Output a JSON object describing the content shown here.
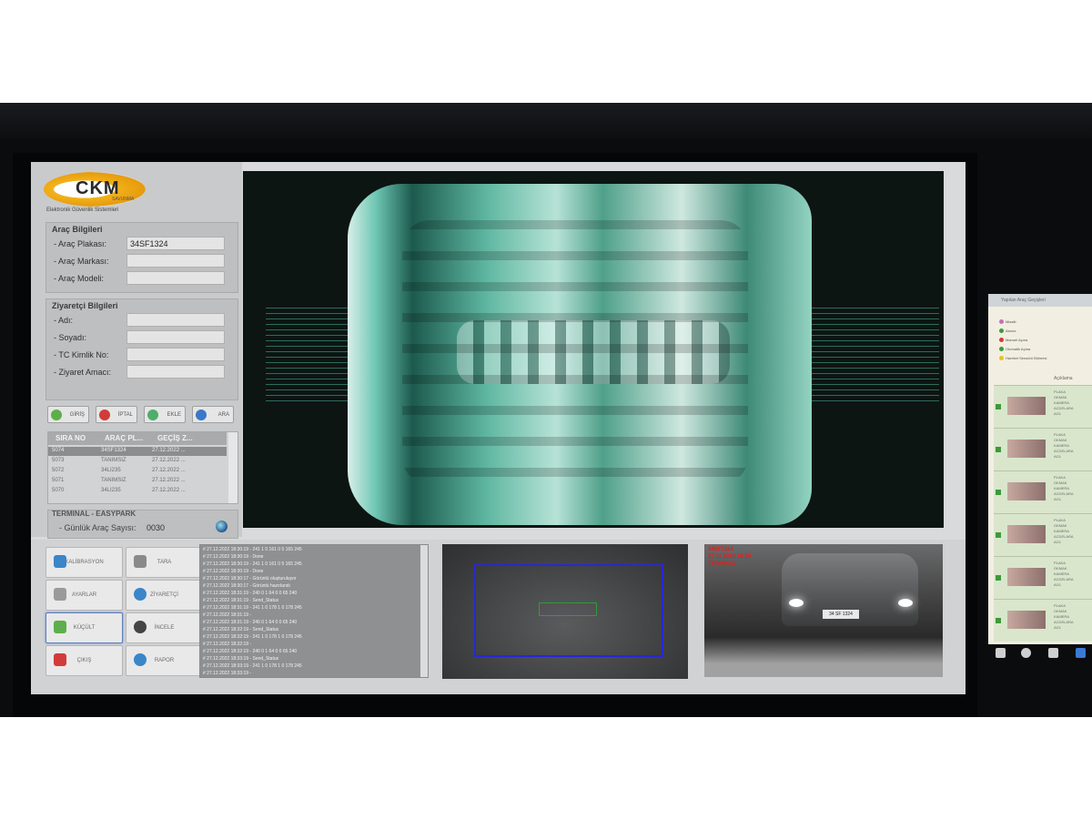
{
  "logo": {
    "name": "CKM",
    "sub": "SAVUNMA",
    "tagline": "Elektronik Güvenlik Sistemleri"
  },
  "vehicle_info": {
    "title": "Araç Bilgileri",
    "plate_label": "- Araç Plakası:",
    "plate_value": "34SF1324",
    "brand_label": "- Araç Markası:",
    "brand_value": "",
    "model_label": "- Araç Modeli:",
    "model_value": ""
  },
  "visitor_info": {
    "title": "Ziyaretçi Bilgileri",
    "name_label": "- Adı:",
    "surname_label": "- Soyadı:",
    "tc_label": "- TC Kimlik No:",
    "purpose_label": "- Ziyaret Amacı:"
  },
  "action_buttons": {
    "giris": "GİRİŞ",
    "iptal": "İPTAL",
    "ekle": "EKLE",
    "ara": "ARA"
  },
  "table": {
    "headers": [
      "SIRA NO",
      "ARAÇ PL...",
      "GEÇİŞ Z..."
    ],
    "rows": [
      [
        "5074",
        "34SF1324",
        "27.12.2022 ..."
      ],
      [
        "5073",
        "TANIMSIZ",
        "27.12.2022 ..."
      ],
      [
        "5072",
        "34LI235",
        "27.12.2022 ..."
      ],
      [
        "5071",
        "TANIMSIZ",
        "27.12.2022 ..."
      ],
      [
        "5070",
        "34LI235",
        "27.12.2022 ..."
      ]
    ]
  },
  "terminal": {
    "title": "TERMINAL - EASYPARK",
    "daily_label": "- Günlük Araç Sayısı:",
    "daily_value": "0030"
  },
  "bottom_buttons": {
    "kalibrasyon": "KALİBRASYON",
    "tara": "TARA",
    "ayarlar": "AYARLAR",
    "ziyaretci": "ZİYARETÇİ",
    "kucult": "KÜÇÜLT",
    "incele": "İNCELE",
    "cikis": "ÇIKIŞ",
    "rapor": "RAPOR"
  },
  "log_lines": [
    "# 27.12.2022 18:30:19 - 241 1 0 161 0 5 165 245",
    "# 27.12.2022 18:30:19 - Done",
    "# 27.12.2022 18:30:19 - 241 1 0 161 0 5 165 245",
    "# 27.12.2022 18:30:19 - Done",
    "# 27.12.2022 18:30:17 - Görüntü oluşturuluyor",
    "# 27.12.2022 18:30:17 - Görüntü hazırlandı",
    "# 27.12.2022 18:31:19 - 240 0 1 64 0 0 65 240",
    "# 27.12.2022 18:31:19 - Send_Status",
    "# 27.12.2022 18:31:19 - 241 1 0 178 1 0 178 245",
    "# 27.12.2022 18:31:19 -",
    "# 27.12.2022 18:31:19 - 240 0 1 64 0 0 65 240",
    "# 27.12.2022 18:32:19 - Send_Status",
    "# 27.12.2022 18:32:19 - 241 1 0 178 1 0 178 245",
    "# 27.12.2022 18:32:19 -",
    "# 27.12.2022 18:32:19 - 240 0 1 64 0 0 65 240",
    "# 27.12.2022 18:33:19 - Send_Status",
    "# 27.12.2022 18:33:19 - 241 1 0 178 1 0 178 245",
    "# 27.12.2022 18:33:19 -"
  ],
  "cam2": {
    "line1": "34SF1324",
    "line2": "27.12.2022 18:20",
    "line3": "TERMINAL",
    "plate": "34 SF 1324"
  },
  "side_panel": {
    "header": "Yapılan Araç Geçişleri",
    "legend": [
      "Misafir",
      "Abone",
      "Manuel Açma",
      "Otomatik Açma",
      "Hareket Sensörü Bölmesi"
    ],
    "column": "Açıklama",
    "row_text": [
      "PLAKA",
      "OKMAK",
      "KAMERA",
      "ACDELARA",
      "AG1"
    ]
  },
  "colors": {
    "accent_orange": "#e79a0b",
    "scan_teal": "#6fc7b4",
    "roi_blue": "#2727d6",
    "roi_green": "#2f9a3f",
    "overlay_red": "#e21d1d"
  }
}
